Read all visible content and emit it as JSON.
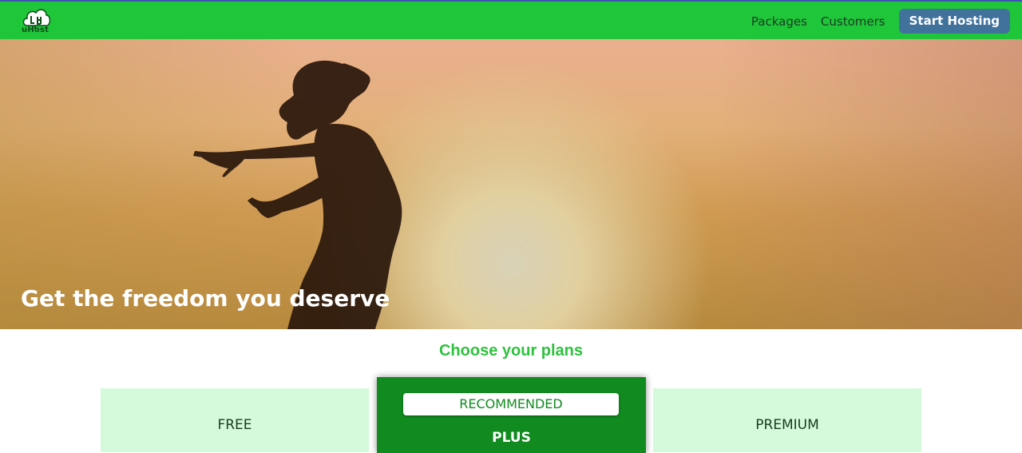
{
  "brand": {
    "name": "uHost",
    "icon": "cloud-logo-icon"
  },
  "nav": {
    "links": [
      "Packages",
      "Customers"
    ],
    "cta_label": "Start Hosting"
  },
  "hero": {
    "title": "Get the freedom you deserve"
  },
  "plans": {
    "heading": "Choose your plans",
    "items": [
      {
        "name": "FREE"
      },
      {
        "name": "PLUS",
        "badge": "RECOMMENDED"
      },
      {
        "name": "PREMIUM"
      }
    ]
  },
  "colors": {
    "header": "#1fc63a",
    "cta": "#41729c",
    "plan_heading": "#2ec23f",
    "plan_card": "#d4fadb",
    "recommended_card": "#118a1f"
  }
}
